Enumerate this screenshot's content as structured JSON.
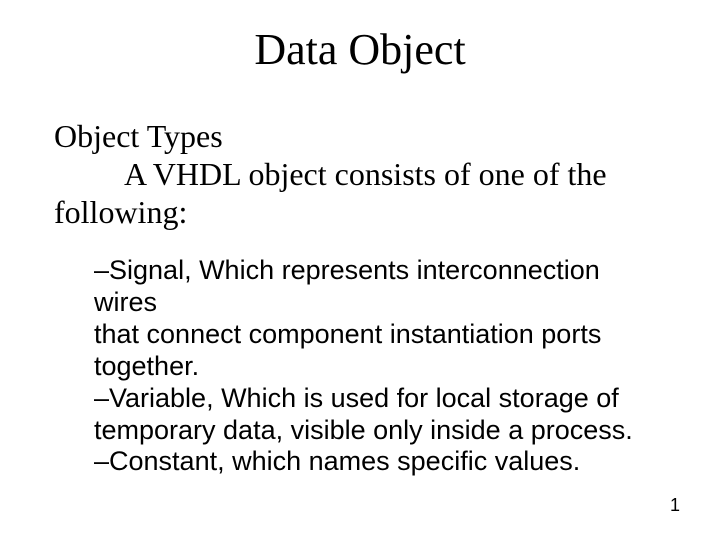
{
  "title": "Data Object",
  "subheading": "Object Types",
  "intro_line2": "A VHDL object consists of one of the",
  "intro_line3": "following:",
  "bullets": {
    "b1l1": "–Signal, Which represents interconnection wires",
    "b1l2": "that connect component instantiation ports",
    "b1l3": "together.",
    "b2l1": "–Variable, Which is used for local storage of",
    "b2l2": "temporary data, visible only inside a process.",
    "b3l1": "–Constant, which names specific values."
  },
  "page_number": "1"
}
